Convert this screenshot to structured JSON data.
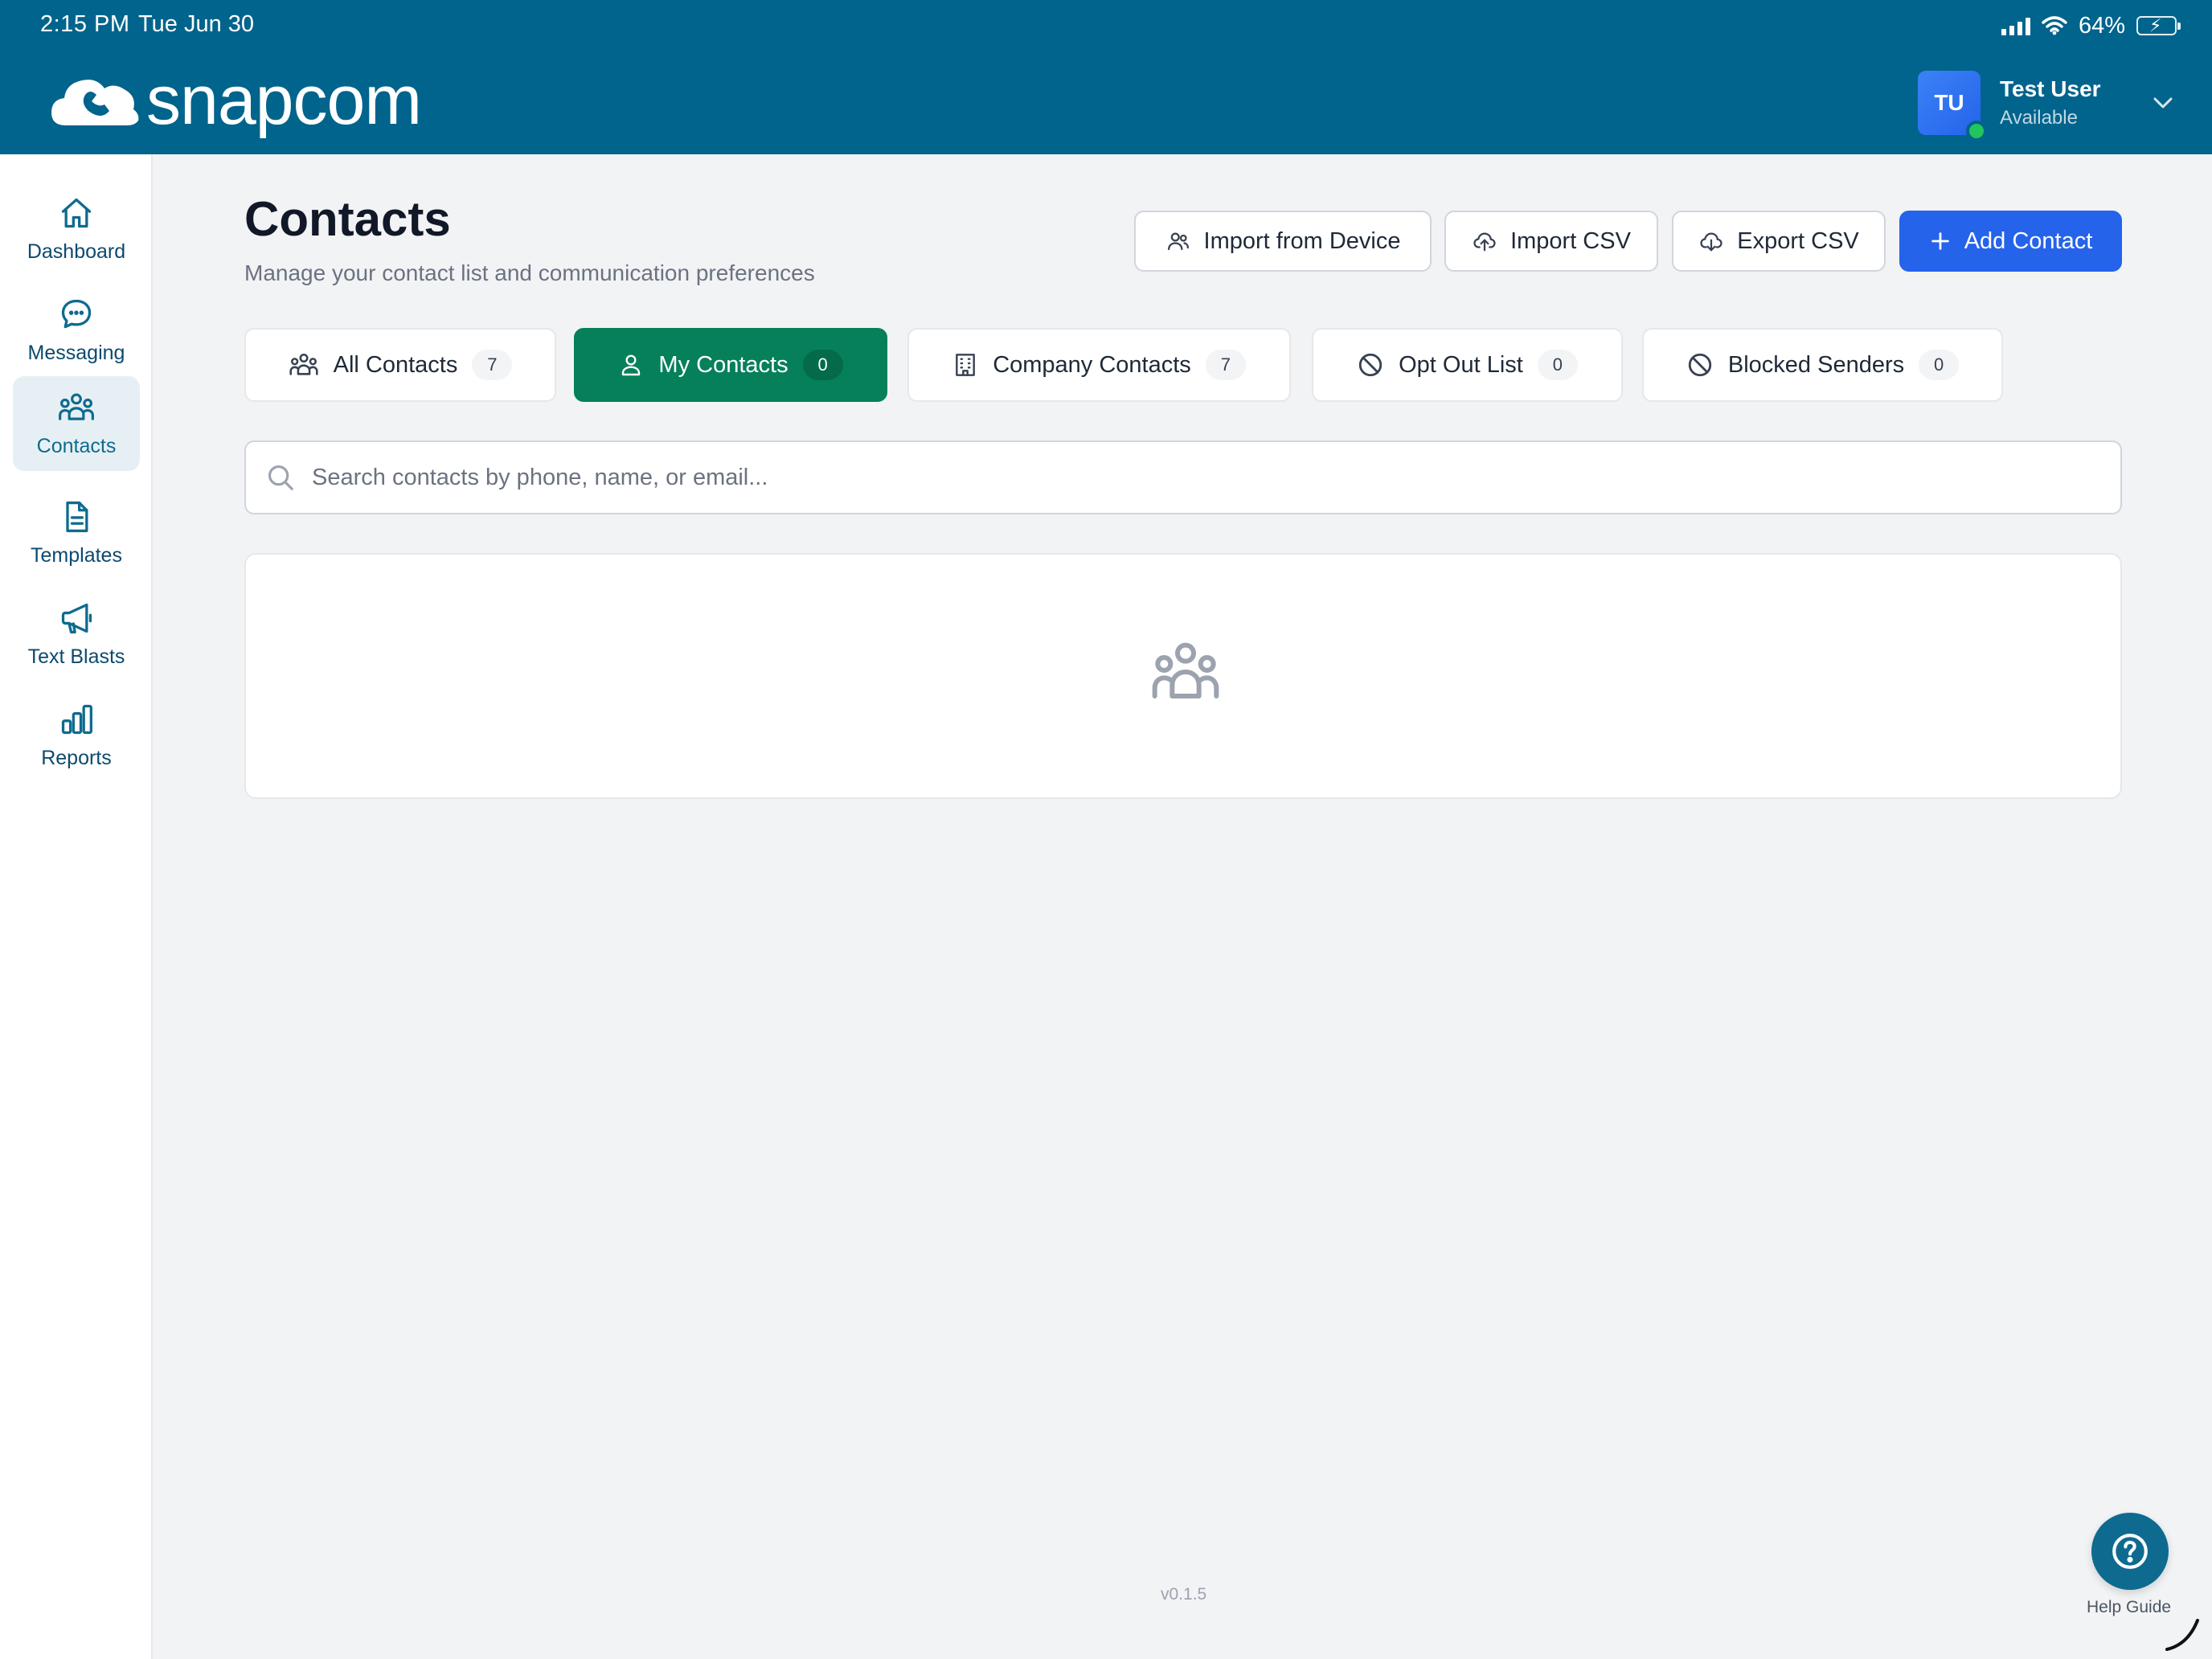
{
  "status_bar": {
    "time": "2:15 PM",
    "date": "Tue Jun 30",
    "battery": "64%"
  },
  "header": {
    "logo_text": "snapcom",
    "user": {
      "initials": "TU",
      "name": "Test User",
      "status": "Available"
    }
  },
  "sidebar": {
    "items": [
      {
        "label": "Dashboard",
        "icon": "home-icon"
      },
      {
        "label": "Messaging",
        "icon": "chat-bubble-icon"
      },
      {
        "label": "Contacts",
        "icon": "users-icon",
        "active": true
      },
      {
        "label": "Templates",
        "icon": "document-icon"
      },
      {
        "label": "Text Blasts",
        "icon": "megaphone-icon"
      },
      {
        "label": "Reports",
        "icon": "bar-chart-icon"
      }
    ]
  },
  "page": {
    "title": "Contacts",
    "subtitle": "Manage your contact list and communication preferences"
  },
  "actions": {
    "import_device": "Import from Device",
    "import_csv": "Import CSV",
    "export_csv": "Export CSV",
    "add_contact": "Add Contact"
  },
  "tabs": [
    {
      "label": "All Contacts",
      "count": "7"
    },
    {
      "label": "My Contacts",
      "count": "0",
      "active": true
    },
    {
      "label": "Company Contacts",
      "count": "7"
    },
    {
      "label": "Opt Out List",
      "count": "0"
    },
    {
      "label": "Blocked Senders",
      "count": "0"
    }
  ],
  "search": {
    "placeholder": "Search contacts by phone, name, or email..."
  },
  "footer": {
    "version": "v0.1.5",
    "help_label": "Help Guide"
  },
  "colors": {
    "header": "#00648c",
    "primary": "#2563eb",
    "active_tab": "#05805a",
    "presence": "#22c55e"
  }
}
